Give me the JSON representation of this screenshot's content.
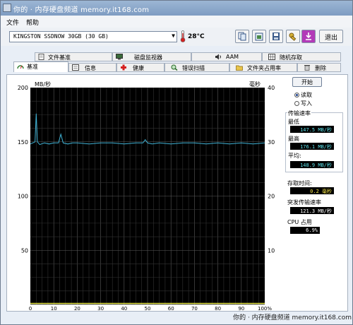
{
  "window": {
    "title": "你的 · 内存硬盘频道 memory.it168.com",
    "menu": [
      "文件",
      "帮助"
    ]
  },
  "toolbar": {
    "drive": "KINGSTON SSDNOW 30GB (30 GB)",
    "temperature": "28°C",
    "exit_label": "退出"
  },
  "tabs_row1": [
    "文件基准",
    "磁盘监视器",
    "AAM",
    "随机存取"
  ],
  "tabs_row2": [
    "基准",
    "信息",
    "健康",
    "错误扫描",
    "文件夹占用率",
    "删除"
  ],
  "controls": {
    "start_label": "开始",
    "radio_read": "读取",
    "radio_write": "写入",
    "selected_mode": "read"
  },
  "stats": {
    "transfer_rate_title": "传输速率",
    "min_label": "最低",
    "min_value": "147.5 MB/秒",
    "max_label": "最高",
    "max_value": "176.1 MB/秒",
    "avg_label": "平均:",
    "avg_value": "148.9 MB/秒",
    "access_time_label": "存取时间:",
    "access_time_value": "0.2 毫秒",
    "burst_label": "突发传输速率",
    "burst_value": "121.3 MB/秒",
    "cpu_label": "CPU 占用",
    "cpu_value": "6.9%"
  },
  "watermark": "你的 · 内存硬盘频道 memory.it168.com",
  "chart_data": {
    "type": "line",
    "ylabel_left": "MB/秒",
    "ylabel_right": "毫秒",
    "left_ticks": [
      200,
      150,
      100,
      50
    ],
    "right_ticks": [
      40,
      30,
      20,
      10
    ],
    "x_ticks": [
      "0",
      "10",
      "20",
      "30",
      "40",
      "50",
      "60",
      "70",
      "80",
      "90",
      "100%"
    ],
    "ylim_left": [
      0,
      200
    ],
    "ylim_right": [
      0,
      40
    ],
    "grid": true,
    "series": [
      {
        "color": "#3fb3d6",
        "x": [
          0,
          1,
          2,
          2.5,
          3,
          4,
          6,
          8,
          10,
          12,
          13,
          14,
          16,
          18,
          20,
          25,
          30,
          35,
          40,
          45,
          48,
          49,
          50,
          52,
          55,
          60,
          65,
          70,
          75,
          80,
          85,
          90,
          95,
          100
        ],
        "y": [
          148,
          149,
          150,
          176,
          150,
          147.5,
          149,
          148,
          149,
          149,
          157,
          149,
          148,
          149,
          149,
          148,
          149,
          149,
          148,
          149,
          149,
          152,
          149,
          148,
          149,
          148,
          149,
          149,
          148,
          149,
          148,
          149,
          148,
          149
        ]
      },
      {
        "color": "#e8e84a",
        "x": [
          0,
          10,
          20,
          30,
          40,
          50,
          60,
          70,
          80,
          90,
          100
        ],
        "y": [
          0.2,
          0.2,
          0.2,
          0.2,
          0.2,
          0.2,
          0.2,
          0.2,
          0.2,
          0.2,
          0.2
        ]
      }
    ]
  }
}
